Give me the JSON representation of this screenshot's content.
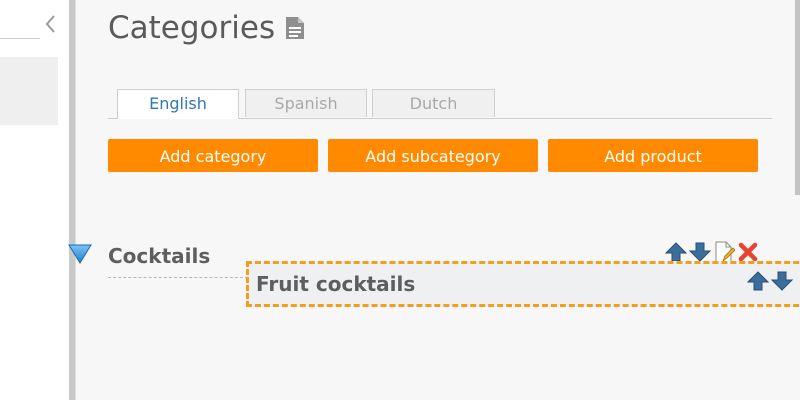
{
  "page": {
    "title": "Categories",
    "title_icon": "document-icon"
  },
  "tabs": [
    {
      "label": "English",
      "active": true
    },
    {
      "label": "Spanish",
      "active": false
    },
    {
      "label": "Dutch",
      "active": false
    }
  ],
  "actions": {
    "add_category": "Add category",
    "add_subcategory": "Add subcategory",
    "add_product": "Add product"
  },
  "tree": {
    "category": {
      "name": "Cocktails",
      "expanded": true,
      "icons": [
        "move-up-icon",
        "move-down-icon",
        "edit-icon",
        "delete-icon"
      ]
    },
    "dragging_item": {
      "name": "Fruit cocktails",
      "icons": [
        "move-up-icon",
        "move-down-icon"
      ]
    }
  },
  "colors": {
    "accent": "#ff8a00",
    "tab_active_text": "#2f78b9",
    "drag_border": "#f0a01e",
    "delete": "#e8432f",
    "arrow": "#3c6e9c",
    "toggle": "#3da0e8"
  }
}
